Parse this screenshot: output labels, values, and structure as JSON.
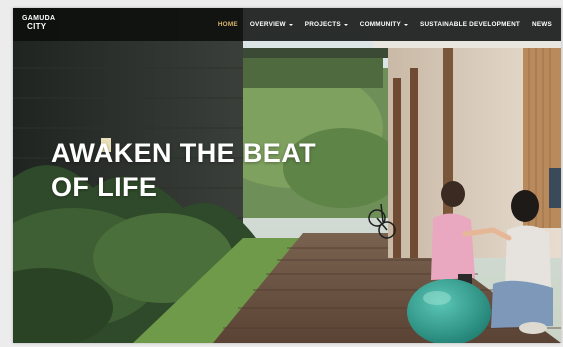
{
  "brand": {
    "logo_line1": "GAMUDA",
    "logo_line2": "CITY"
  },
  "nav": {
    "items": [
      {
        "label": "HOME",
        "active": true,
        "dropdown": false
      },
      {
        "label": "OVERVIEW",
        "active": false,
        "dropdown": true
      },
      {
        "label": "PROJECTS",
        "active": false,
        "dropdown": true
      },
      {
        "label": "COMMUNITY",
        "active": false,
        "dropdown": true
      },
      {
        "label": "SUSTAINABLE DEVELOPMENT",
        "active": false,
        "dropdown": false
      },
      {
        "label": "NEWS",
        "active": false,
        "dropdown": false
      }
    ],
    "active_color": "#d6b46d"
  },
  "hero": {
    "headline_line1": "AWAKEN THE BEAT",
    "headline_line2": "OF LIFE"
  }
}
